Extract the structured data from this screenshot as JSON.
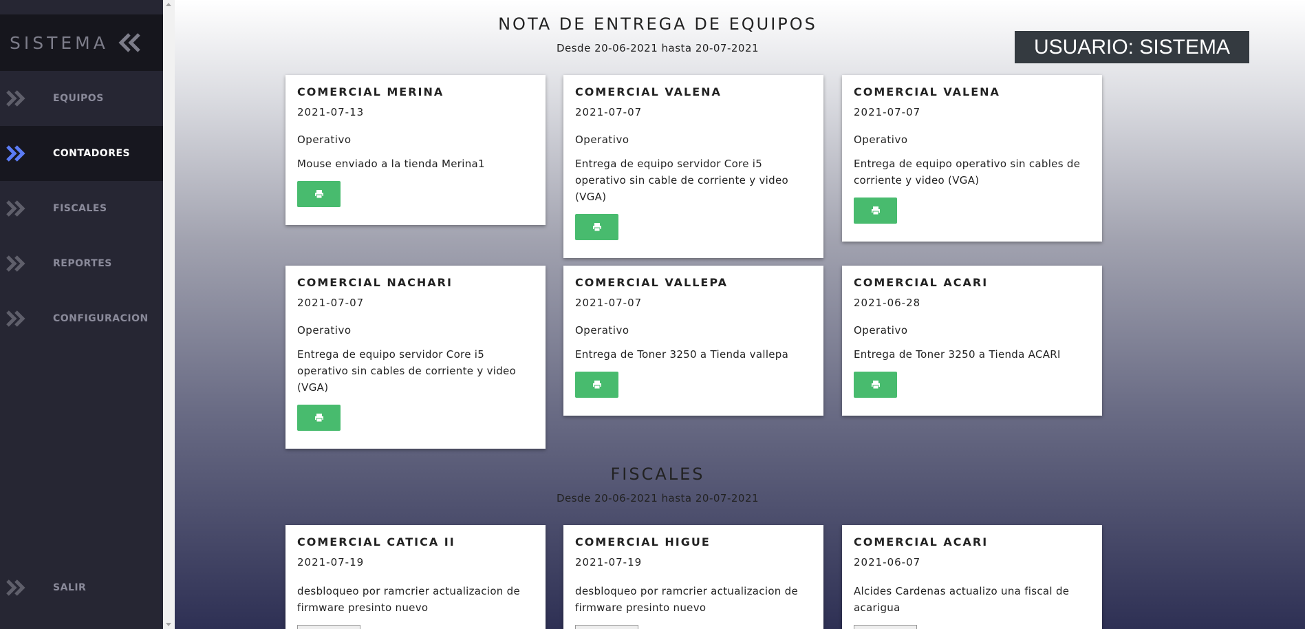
{
  "sidebar": {
    "brand": "SISTEMA",
    "items": [
      {
        "label": "EQUIPOS"
      },
      {
        "label": "CONTADORES"
      },
      {
        "label": "FISCALES"
      },
      {
        "label": "REPORTES"
      },
      {
        "label": "CONFIGURACION"
      }
    ],
    "logout": "SALIR",
    "active_item": "CONTADORES",
    "active_color": "#5b7cf5"
  },
  "user": {
    "label": "USUARIO: SISTEMA"
  },
  "sections": [
    {
      "title": "NOTA DE ENTREGA DE EQUIPOS",
      "subtitle": "Desde 20-06-2021 hasta 20-07-2021",
      "cards": [
        {
          "title": "COMERCIAL MERINA",
          "date": "2021-07-13",
          "status": "Operativo",
          "desc": "Mouse enviado a la tienda Merina1"
        },
        {
          "title": "COMERCIAL VALENA",
          "date": "2021-07-07",
          "status": "Operativo",
          "desc": "Entrega de equipo servidor Core i5 operativo sin cable de corriente y video (VGA)"
        },
        {
          "title": "COMERCIAL VALENA",
          "date": "2021-07-07",
          "status": "Operativo",
          "desc": "Entrega de equipo operativo sin cables de corriente y video (VGA)"
        },
        {
          "title": "COMERCIAL NACHARI",
          "date": "2021-07-07",
          "status": "Operativo",
          "desc": "Entrega de equipo servidor Core i5 operativo sin cables de corriente y video (VGA)"
        },
        {
          "title": "COMERCIAL VALLEPA",
          "date": "2021-07-07",
          "status": "Operativo",
          "desc": "Entrega de Toner 3250 a Tienda vallepa"
        },
        {
          "title": "COMERCIAL ACARI",
          "date": "2021-06-28",
          "status": "Operativo",
          "desc": "Entrega de Toner 3250 a Tienda ACARI"
        }
      ]
    },
    {
      "title": "FISCALES",
      "subtitle": "Desde 20-06-2021 hasta 20-07-2021",
      "cards": [
        {
          "title": "COMERCIAL CATICA II",
          "date": "2021-07-19",
          "desc": "desbloqueo por ramcrier actualizacion de firmware presinto nuevo"
        },
        {
          "title": "COMERCIAL HIGUE",
          "date": "2021-07-19",
          "desc": "desbloqueo por ramcrier actualizacion de firmware presinto nuevo"
        },
        {
          "title": "COMERCIAL ACARI",
          "date": "2021-06-07",
          "desc": "Alcides Cardenas actualizo una fiscal de acarigua"
        }
      ]
    }
  ],
  "colors": {
    "print_button": "#48bb6e",
    "user_box": "#343a40",
    "sidebar": "#262633"
  },
  "icons": {
    "nav": "double-chevron-right-icon",
    "collapse": "double-chevron-left-icon",
    "print": "printer-icon"
  }
}
